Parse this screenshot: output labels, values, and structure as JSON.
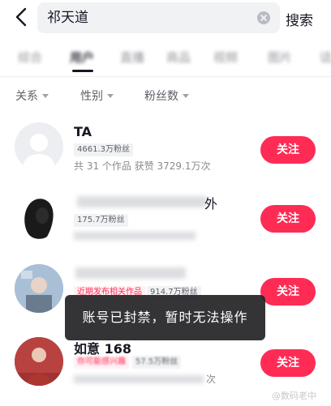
{
  "search": {
    "query": "祁天道",
    "submit_label": "搜索"
  },
  "tabs": [
    {
      "label": "综合",
      "active": false
    },
    {
      "label": "用户",
      "active": true
    },
    {
      "label": "直播",
      "active": false
    },
    {
      "label": "商品",
      "active": false
    },
    {
      "label": "视频",
      "active": false
    },
    {
      "label": "图片",
      "active": false
    },
    {
      "label": "话",
      "active": false
    }
  ],
  "filters": [
    {
      "label": "关系"
    },
    {
      "label": "性别"
    },
    {
      "label": "粉丝数"
    }
  ],
  "results": [
    {
      "name": "TA",
      "fans": "4661.3万粉丝",
      "stats": "共 31 个作品 获赞 3729.1万次",
      "follow_label": "关注"
    },
    {
      "name": "外",
      "fans": "175.7万粉丝",
      "follow_label": "关注"
    },
    {
      "recent_tag": "近期发布相关作品",
      "fans": "914.7万粉丝",
      "follow_label": "关注"
    },
    {
      "name": "如意 168",
      "tag": "你可能感兴趣",
      "fans": "57.5万粉丝",
      "stats_tail": "次",
      "follow_label": "关注"
    }
  ],
  "toast": "账号已封禁，暂时无法操作",
  "watermark": "@数码老中",
  "colors": {
    "accent": "#fe2c55",
    "text": "#161823",
    "muted": "#8a8b91",
    "search_bg": "#f1f2f4",
    "toast_bg": "#232326"
  },
  "icons": {
    "back": "chevron-left-icon",
    "clear": "clear-circle-icon",
    "caret": "caret-down-icon",
    "avatar_default": "default-avatar-icon"
  }
}
